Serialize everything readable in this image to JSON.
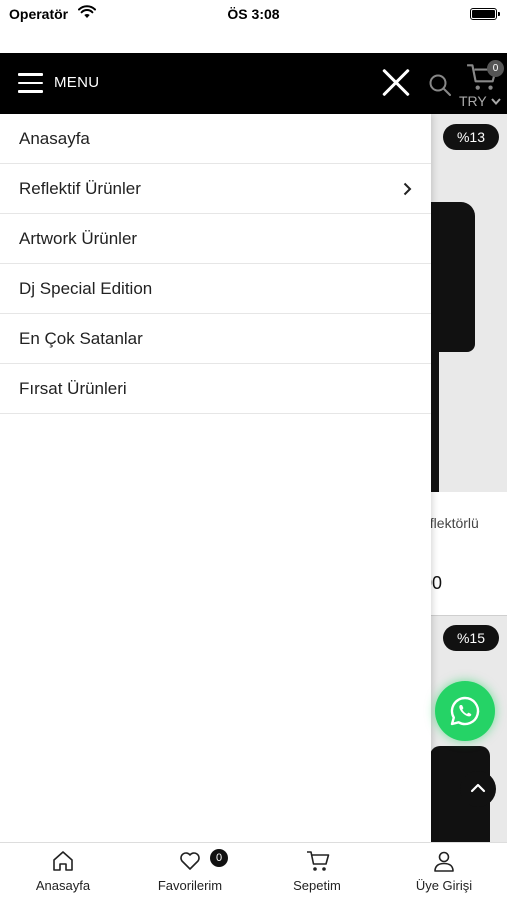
{
  "status_bar": {
    "carrier": "Operatör",
    "time": "ÖS 3:08"
  },
  "header": {
    "menu_label": "MENU",
    "cart_count": "0",
    "currency": "TRY"
  },
  "drawer": {
    "items": [
      {
        "label": "Anasayfa",
        "has_submenu": false
      },
      {
        "label": "Reflektif Ürünler",
        "has_submenu": true
      },
      {
        "label": "Artwork Ürünler",
        "has_submenu": false
      },
      {
        "label": "Dj Special Edition",
        "has_submenu": false
      },
      {
        "label": "En Çok Satanlar",
        "has_submenu": false
      },
      {
        "label": "Fırsat Ürünleri",
        "has_submenu": false
      }
    ]
  },
  "products_behind": [
    {
      "discount_badge": "%13",
      "name_fragment": "eflektörlü",
      "price_fragment": "00"
    },
    {
      "discount_badge": "%15"
    }
  ],
  "bottom_nav": {
    "items": [
      {
        "label": "Anasayfa",
        "icon": "home-icon"
      },
      {
        "label": "Favorilerim",
        "icon": "heart-icon",
        "badge": "0"
      },
      {
        "label": "Sepetim",
        "icon": "cart-icon"
      },
      {
        "label": "Üye Girişi",
        "icon": "user-icon"
      }
    ]
  },
  "colors": {
    "header_bg": "#000000",
    "whatsapp": "#25d366",
    "accent": "#111111"
  }
}
